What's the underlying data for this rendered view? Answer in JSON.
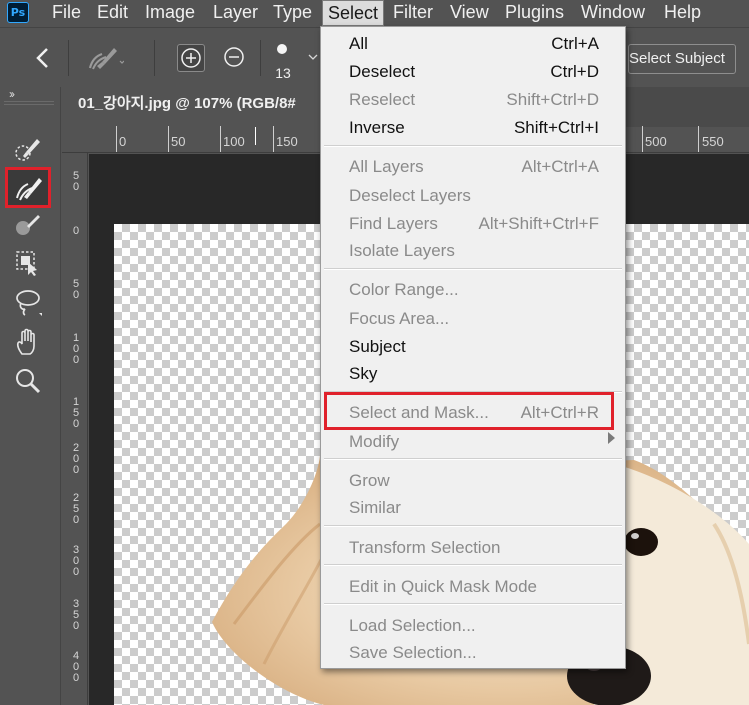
{
  "app": {
    "logo": "Ps"
  },
  "menubar": {
    "items": [
      "File",
      "Edit",
      "Image",
      "Layer",
      "Type",
      "Select",
      "Filter",
      "View",
      "Plugins",
      "Window",
      "Help"
    ],
    "active": "Select"
  },
  "options": {
    "brush_size": "13",
    "select_subject_label": "Select Subject"
  },
  "toolbar": {
    "collapse_glyph": "››",
    "tools": [
      "quick-selection-tool",
      "refine-edge-brush-tool",
      "brush-tool",
      "object-selection-tool",
      "lasso-tool",
      "hand-tool",
      "zoom-tool"
    ],
    "highlighted_tool": "refine-edge-brush-tool"
  },
  "document": {
    "tab_title": "01_강아지.jpg @ 107% (RGB/8#"
  },
  "rulers": {
    "top": [
      "0",
      "50",
      "100",
      "150",
      "500",
      "550"
    ],
    "left": [
      "50",
      "0",
      "50",
      "100",
      "150",
      "200",
      "250",
      "300",
      "350",
      "400"
    ]
  },
  "select_menu": {
    "items": [
      {
        "label": "All",
        "shortcut": "Ctrl+A",
        "enabled": true
      },
      {
        "label": "Deselect",
        "shortcut": "Ctrl+D",
        "enabled": true
      },
      {
        "label": "Reselect",
        "shortcut": "Shift+Ctrl+D",
        "enabled": false
      },
      {
        "label": "Inverse",
        "shortcut": "Shift+Ctrl+I",
        "enabled": true
      },
      {
        "label": "All Layers",
        "shortcut": "Alt+Ctrl+A",
        "enabled": false
      },
      {
        "label": "Deselect Layers",
        "shortcut": "",
        "enabled": false
      },
      {
        "label": "Find Layers",
        "shortcut": "Alt+Shift+Ctrl+F",
        "enabled": false
      },
      {
        "label": "Isolate Layers",
        "shortcut": "",
        "enabled": false
      },
      {
        "label": "Color Range...",
        "shortcut": "",
        "enabled": false
      },
      {
        "label": "Focus Area...",
        "shortcut": "",
        "enabled": false
      },
      {
        "label": "Subject",
        "shortcut": "",
        "enabled": true
      },
      {
        "label": "Sky",
        "shortcut": "",
        "enabled": true
      },
      {
        "label": "Select and Mask...",
        "shortcut": "Alt+Ctrl+R",
        "enabled": false,
        "highlighted": true
      },
      {
        "label": "Modify",
        "shortcut": "",
        "enabled": false,
        "submenu": true
      },
      {
        "label": "Grow",
        "shortcut": "",
        "enabled": false
      },
      {
        "label": "Similar",
        "shortcut": "",
        "enabled": false
      },
      {
        "label": "Transform Selection",
        "shortcut": "",
        "enabled": false
      },
      {
        "label": "Edit in Quick Mask Mode",
        "shortcut": "",
        "enabled": false
      },
      {
        "label": "Load Selection...",
        "shortcut": "",
        "enabled": false
      },
      {
        "label": "Save Selection...",
        "shortcut": "",
        "enabled": false
      }
    ]
  },
  "colors": {
    "panel": "#535353",
    "canvas_surround": "#282828",
    "highlight_red": "#e0212b",
    "menu_bg": "#f0f0f0"
  }
}
